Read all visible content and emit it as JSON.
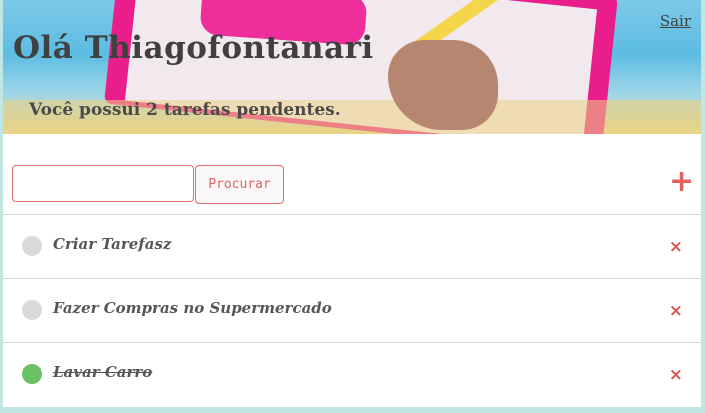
{
  "header": {
    "greeting": "Olá Thiagofontanari",
    "pending_text": "Você possui 2 tarefas pendentes.",
    "logout_label": "Sair"
  },
  "search": {
    "input_value": "",
    "button_label": "Procurar"
  },
  "add_icon": "+",
  "delete_icon": "×",
  "tasks": [
    {
      "label": "Criar Tarefasz",
      "done": false
    },
    {
      "label": "Fazer Compras no Supermercado",
      "done": false
    },
    {
      "label": "Lavar Carro",
      "done": true
    }
  ],
  "colors": {
    "accent": "#e3615f",
    "done": "#6cc066",
    "pending": "#d9d9d9"
  }
}
